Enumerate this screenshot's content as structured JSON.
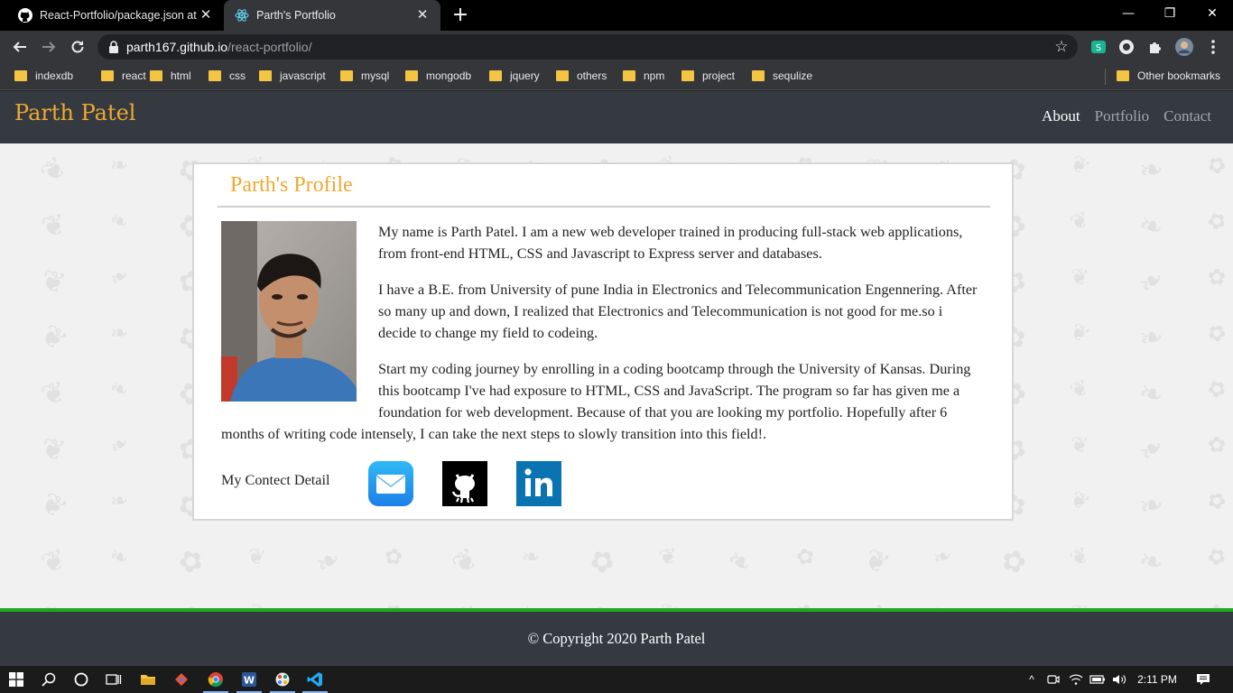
{
  "browser": {
    "tabs": [
      {
        "title": "React-Portfolio/package.json at m",
        "favicon": "github-icon"
      },
      {
        "title": "Parth's Portfolio",
        "favicon": "react-icon"
      }
    ],
    "close_glyph": "✕",
    "new_tab_glyph": "+",
    "url_host": "parth167.github.io",
    "url_path": "/react-portfolio/",
    "bookmarks": [
      "indexdb",
      "react",
      "html",
      "css",
      "javascript",
      "mysql",
      "mongodb",
      "jquery",
      "others",
      "npm",
      "project",
      "sequlize"
    ],
    "other_bookmarks": "Other bookmarks"
  },
  "site": {
    "brand": "Parth Patel",
    "nav": [
      "About",
      "Portfolio",
      "Contact"
    ],
    "active_nav": "About"
  },
  "profile": {
    "title": "Parth's Profile",
    "paragraphs": [
      "My name is Parth Patel. I am a new web developer trained in producing full-stack web applications, from front-end HTML, CSS and Javascript to Express server and databases.",
      "I have a B.E. from University of pune India in Electronics and Telecommunication Engennering. After so many up and down, I realized that Electronics and Telecommunication is not good for me.so i decide to change my field to codeing.",
      "Start my coding journey by enrolling in a coding bootcamp through the University of Kansas. During this bootcamp I've had exposure to HTML, CSS and JavaScript. The program so far has given me a foundation for web development. Because of that you are looking my portfolio. Hopefully after 6 months of writing code intensely, I can take the next steps to slowly transition into this field!."
    ],
    "contact_label": "My Contect Detail",
    "contact_icons": [
      "mail-icon",
      "github-icon",
      "linkedin-icon"
    ]
  },
  "footer": {
    "text": "© Copyright 2020 Parth Patel"
  },
  "taskbar": {
    "time": "2:11 PM"
  },
  "colors": {
    "accent": "#f0a830",
    "header_bg": "#343a40",
    "footer_line": "#1fa81f"
  }
}
